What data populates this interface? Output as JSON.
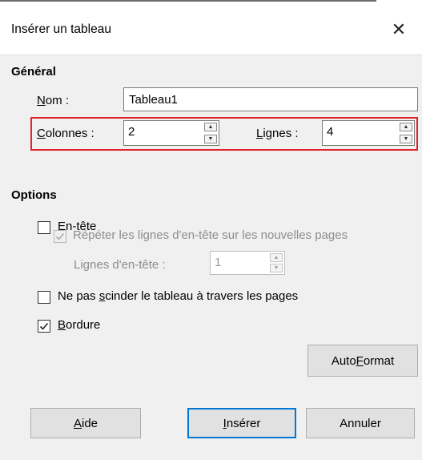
{
  "window": {
    "title": "Insérer un tableau",
    "close_label": "✕"
  },
  "general": {
    "heading": "Général",
    "name_label_u": "N",
    "name_label_rest": "om :",
    "name_value": "Tableau1",
    "columns_label_u": "C",
    "columns_label_rest": "olonnes :",
    "columns_value": "2",
    "rows_label_u": "L",
    "rows_label_rest": "ignes :",
    "rows_value": "4"
  },
  "options": {
    "heading": "Options",
    "header_u": "E",
    "header_rest": "n-tête",
    "header_checked": false,
    "repeat_text": "Répéter les lignes d'en-tête sur les nouvelles pages",
    "repeat_checked": true,
    "header_rows_label": "Lignes d'en-tête :",
    "header_rows_value": "1",
    "dont_split_pre": "Ne pas ",
    "dont_split_u": "s",
    "dont_split_post": "cinder le tableau à travers les pages",
    "dont_split_checked": false,
    "border_u": "B",
    "border_rest": "ordure",
    "border_checked": true
  },
  "buttons": {
    "autoformat_pre": "Auto",
    "autoformat_u": "F",
    "autoformat_post": "ormat",
    "help_u": "A",
    "help_rest": "ide",
    "insert_u": "I",
    "insert_rest": "nsérer",
    "cancel": "Annuler"
  },
  "icons": [
    "close-icon",
    "spin-up-icon",
    "spin-down-icon",
    "checkmark-icon"
  ]
}
